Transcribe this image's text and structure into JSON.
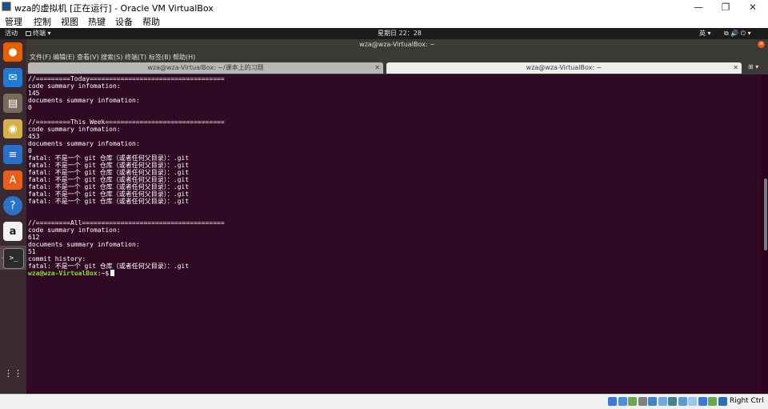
{
  "window": {
    "title": "wza的虚拟机 [正在运行] - Oracle VM VirtualBox",
    "minimize_icon": "—",
    "restore_icon": "❐",
    "close_icon": "✕"
  },
  "vbox_menu": [
    "管理",
    "控制",
    "视图",
    "热键",
    "设备",
    "帮助"
  ],
  "guest_topbar": {
    "activities": "活动",
    "app_menu": "终端 ▾",
    "clock": "星期日 22：28",
    "input_method": "英 ▾",
    "tray_icons": "⧉  🔊  ⏻ ▾"
  },
  "terminal_window": {
    "title": "wza@wza-VirtualBox: ~",
    "menu": [
      "文件(F)",
      "编辑(E)",
      "查看(V)",
      "搜索(S)",
      "终端(T)",
      "标签(B)",
      "帮助(H)"
    ],
    "tabs": [
      {
        "label": "wza@wza-VirtualBox: ~/课本上的习题",
        "close": "✕"
      },
      {
        "label": "wza@wza-VirtualBox: ~",
        "close": "✕"
      }
    ],
    "new_tab_icon": "⊞ ▾"
  },
  "terminal": {
    "lines": [
      "//=========Today===================================",
      "code summary infomation:",
      "145",
      "documents summary infomation:",
      "0",
      "",
      "//=========This Week===============================",
      "code summary infomation:",
      "453",
      "documents summary infomation:",
      "0",
      "fatal: 不是一个 git 仓库（或者任何父目录）：.git",
      "fatal: 不是一个 git 仓库（或者任何父目录）：.git",
      "fatal: 不是一个 git 仓库（或者任何父目录）：.git",
      "fatal: 不是一个 git 仓库（或者任何父目录）：.git",
      "fatal: 不是一个 git 仓库（或者任何父目录）：.git",
      "fatal: 不是一个 git 仓库（或者任何父目录）：.git",
      "fatal: 不是一个 git 仓库（或者任何父目录）：.git",
      "",
      "",
      "//=========All=====================================",
      "code summary infomation:",
      "612",
      "documents summary infomation:",
      "51",
      "commit history:",
      "fatal: 不是一个 git 仓库（或者任何父目录）：.git"
    ],
    "prompt_user": "wza@wza-VirtualBox",
    "prompt_path": ":~$"
  },
  "dock": [
    {
      "name": "firefox",
      "glyph": "●",
      "color": "#e66000"
    },
    {
      "name": "thunderbird",
      "glyph": "✉",
      "color": "#1f7ad1"
    },
    {
      "name": "files",
      "glyph": "▤",
      "color": "#7e6a58"
    },
    {
      "name": "rhythmbox",
      "glyph": "◉",
      "color": "#d6b34a"
    },
    {
      "name": "libreoffice-writer",
      "glyph": "≡",
      "color": "#2a6fc9"
    },
    {
      "name": "software",
      "glyph": "A",
      "color": "#e85e18"
    },
    {
      "name": "help",
      "glyph": "?",
      "color": "#2a73c9"
    },
    {
      "name": "amazon",
      "glyph": "a",
      "color": "#f2f2f2"
    },
    {
      "name": "terminal",
      "glyph": ">_",
      "color": "#2b2b2b"
    }
  ],
  "apps_grid_icon": "⋮⋮⋮",
  "statusbar": {
    "host_key": "Right Ctrl",
    "icon_colors": [
      "#3c78d8",
      "#4a90d9",
      "#6aa84f",
      "#7f7f7f",
      "#3d85c6",
      "#6fa8dc",
      "#45818e",
      "#5b9bd5",
      "#9fc5e8",
      "#3c78d8",
      "#6aa84f",
      "#2f6db5"
    ]
  },
  "colors": {
    "terminal_bg": "#300a24",
    "prompt": "#8ae234",
    "dock_bg": "#3a2b32"
  }
}
